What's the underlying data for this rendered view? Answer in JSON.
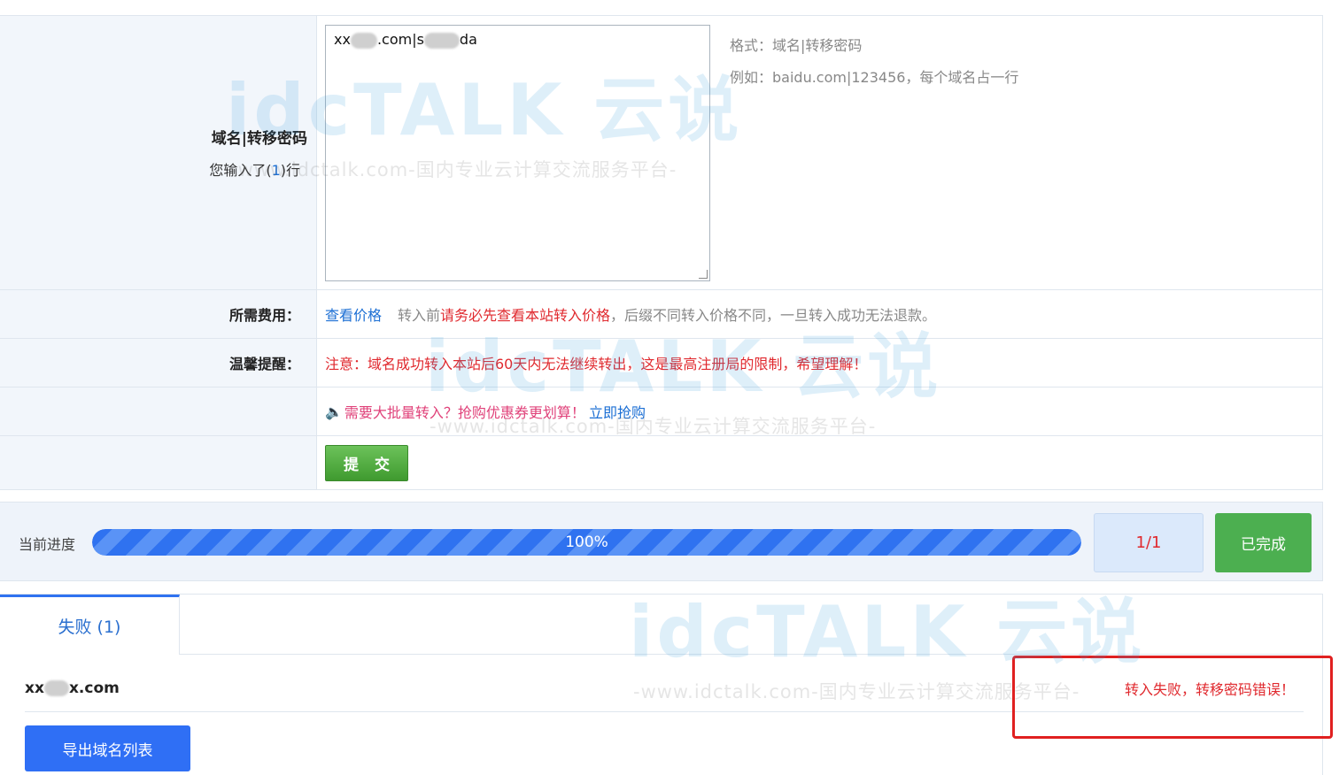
{
  "form": {
    "domain_label": "域名|转移密码",
    "count_prefix": "您输入了(",
    "count_value": "1",
    "count_suffix": ")行",
    "textarea_value": ".com|s",
    "textarea_prefix": "xx",
    "textarea_tail": "da",
    "hint_format": "格式：域名|转移密码",
    "hint_example": "例如：baidu.com|123456，每个域名占一行",
    "fee_label": "所需费用：",
    "fee_link": "查看价格",
    "fee_text_1": "转入前",
    "fee_text_red": "请务必先查看本站转入价格",
    "fee_text_2": "，后缀不同转入价格不同，一旦转入成功无法退款。",
    "tip_label": "温馨提醒：",
    "tip_text": "注意：域名成功转入本站后60天内无法继续转出，这是最高注册局的限制，希望理解！",
    "promo_text": "需要大批量转入？抢购优惠券更划算！",
    "promo_link": "立即抢购",
    "submit_label": "提 交"
  },
  "progress": {
    "label": "当前进度",
    "percent": 100,
    "percent_text": "100%",
    "counter": "1/1",
    "status": "已完成"
  },
  "results": {
    "tab_label": "失败 (1)",
    "domain_prefix": "xx",
    "domain_suffix": "x.com",
    "message": "转入失败，转移密码错误！",
    "export_label": "导出域名列表"
  },
  "watermark": {
    "logo": "idcTALK 云说",
    "sub": "-www.idctalk.com-国内专业云计算交流服务平台-"
  }
}
